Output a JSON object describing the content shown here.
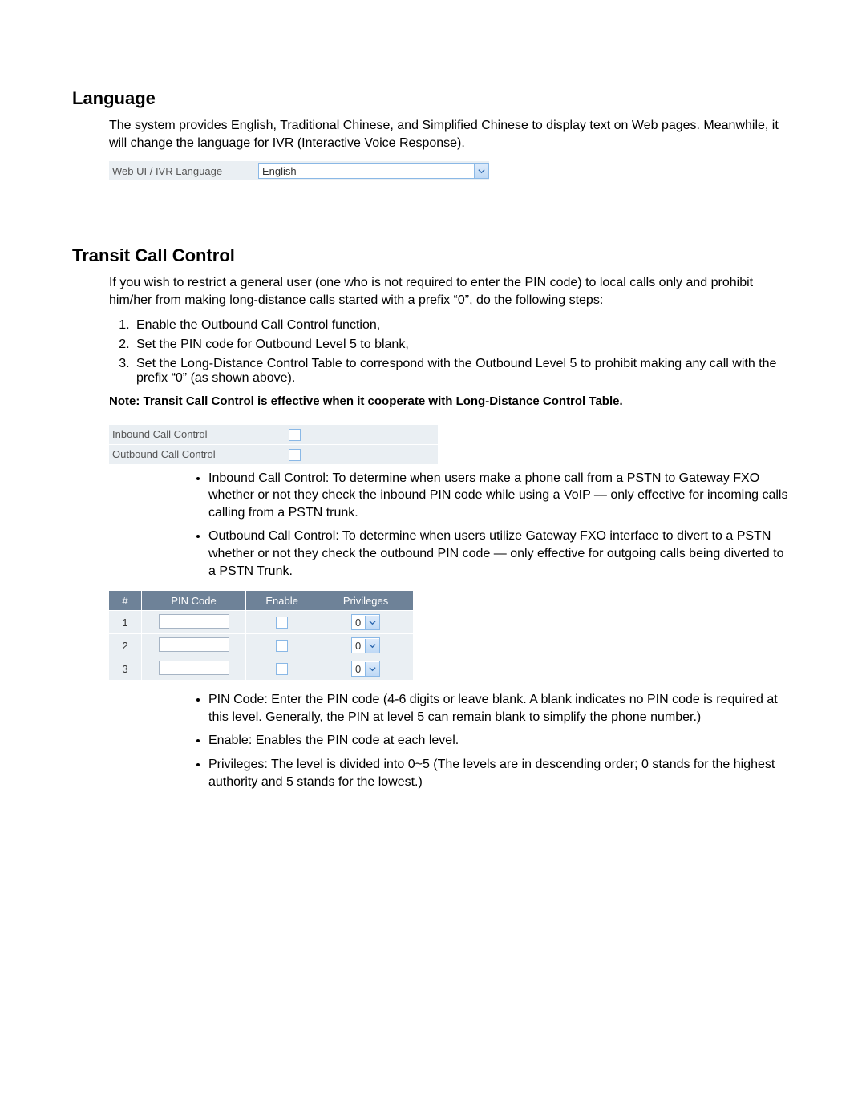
{
  "language_section": {
    "heading": "Language",
    "paragraph": "The system provides English, Traditional Chinese, and Simplified Chinese to display text on Web pages. Meanwhile, it will change the language for IVR (Interactive Voice Response).",
    "field_label": "Web UI / IVR Language",
    "field_value": "English"
  },
  "transit_section": {
    "heading": "Transit Call Control",
    "intro": "If you wish to restrict a general user (one who is not required to enter the PIN code) to local calls only and prohibit him/her from making long-distance calls started with a prefix “0”, do the following steps:",
    "steps": [
      "Enable the Outbound Call Control function,",
      "Set the PIN code for Outbound Level 5 to blank,",
      "Set the Long-Distance Control Table to correspond with the Outbound Level 5 to prohibit making any call with the prefix “0” (as shown above)."
    ],
    "note": "Note: Transit Call Control is effective when it cooperate with Long-Distance Control Table.",
    "toggles": [
      "Inbound Call Control",
      "Outbound Call Control"
    ],
    "toggle_desc": [
      "Inbound Call Control: To determine when users make a phone call from a PSTN to Gateway FXO whether or not they check the inbound PIN code while using a VoIP — only effective for incoming calls calling from a PSTN trunk.",
      "Outbound Call Control: To determine when users utilize Gateway FXO interface to divert to a PSTN whether or not they check the outbound PIN code — only effective for outgoing calls being diverted to a PSTN Trunk."
    ],
    "pin_table": {
      "headers": [
        "#",
        "PIN Code",
        "Enable",
        "Privileges"
      ],
      "rows": [
        {
          "num": "1",
          "priv": "0"
        },
        {
          "num": "2",
          "priv": "0"
        },
        {
          "num": "3",
          "priv": "0"
        }
      ]
    },
    "pin_desc": [
      "PIN Code: Enter the PIN code (4-6 digits or leave blank. A blank indicates no PIN code is required at this level. Generally, the PIN at level 5 can remain blank to simplify the phone number.)",
      "Enable: Enables the PIN code at each level.",
      "Privileges: The level is divided into 0~5 (The levels are in descending order; 0 stands for the highest authority and 5 stands for the lowest.)"
    ]
  }
}
